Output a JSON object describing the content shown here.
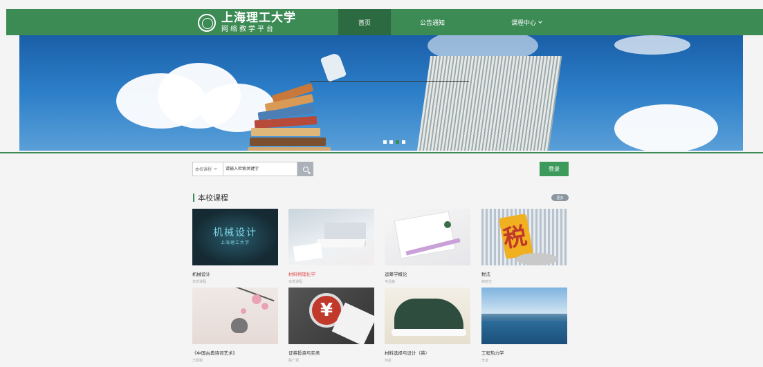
{
  "header": {
    "logo": {
      "title": "上海理工大学",
      "subtitle": "网络教学平台"
    },
    "nav": [
      {
        "label": "首页",
        "active": true
      },
      {
        "label": "公告通知",
        "active": false
      },
      {
        "label": "课程中心",
        "active": false,
        "has_dropdown": true
      }
    ]
  },
  "banner": {
    "slide_count": 3,
    "active_slide": 2
  },
  "search": {
    "scope": "本校课程",
    "placeholder": "请输入检索关键字",
    "button_icon": "search-icon"
  },
  "login_label": "登录",
  "section": {
    "title": "本校课程",
    "more_label": "更多"
  },
  "courses": [
    {
      "name": "机械设计",
      "sub": "本校课程",
      "thumb_text": "机械设计",
      "thumb_subtext": "上海理工大学"
    },
    {
      "name": "材料物理化学",
      "sub": "本校课程",
      "highlight": true
    },
    {
      "name": "运筹学概论",
      "sub": "韦显静"
    },
    {
      "name": "税法",
      "sub": "薛晓艺",
      "thumb_text": "税"
    },
    {
      "name": "《中国古典诗词艺术》",
      "sub": "王勤勤"
    },
    {
      "name": "证券投资与实务",
      "sub": "殷广源",
      "thumb_text": "¥"
    },
    {
      "name": "材料选择与设计（英）",
      "sub": "何星"
    },
    {
      "name": "工程热力学",
      "sub": "李凌"
    }
  ],
  "colors": {
    "primary": "#3c8b55",
    "primary_dark": "#2c6b42",
    "login": "#3c9b5b",
    "highlight": "#e05050"
  }
}
